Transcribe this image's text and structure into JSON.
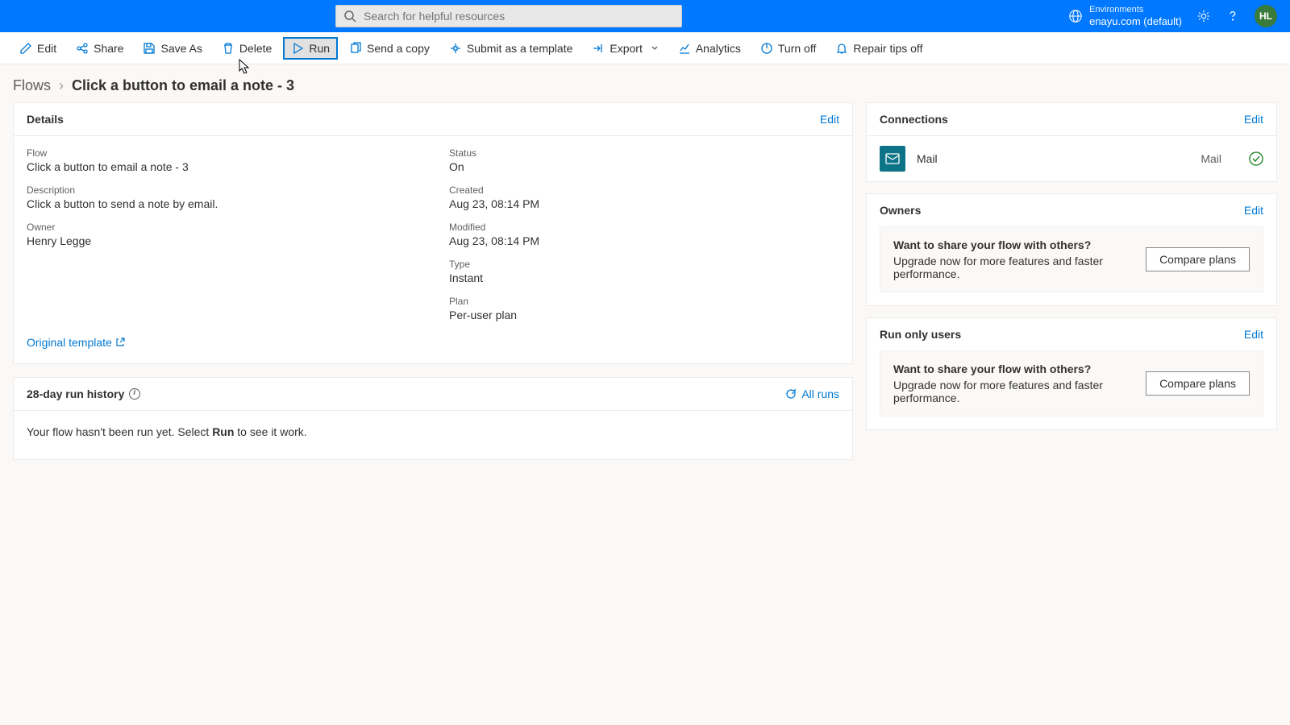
{
  "header": {
    "search_placeholder": "Search for helpful resources",
    "env_label": "Environments",
    "env_name": "enayu.com (default)",
    "avatar_initials": "HL"
  },
  "commands": {
    "edit": "Edit",
    "share": "Share",
    "save_as": "Save As",
    "delete": "Delete",
    "run": "Run",
    "send_copy": "Send a copy",
    "submit_template": "Submit as a template",
    "export": "Export",
    "analytics": "Analytics",
    "turn_off": "Turn off",
    "repair_tips_off": "Repair tips off"
  },
  "breadcrumb": {
    "root": "Flows",
    "current": "Click a button to email a note - 3"
  },
  "details": {
    "title": "Details",
    "edit": "Edit",
    "flow_label": "Flow",
    "flow_value": "Click a button to email a note - 3",
    "desc_label": "Description",
    "desc_value": "Click a button to send a note by email.",
    "owner_label": "Owner",
    "owner_value": "Henry Legge",
    "status_label": "Status",
    "status_value": "On",
    "created_label": "Created",
    "created_value": "Aug 23, 08:14 PM",
    "modified_label": "Modified",
    "modified_value": "Aug 23, 08:14 PM",
    "type_label": "Type",
    "type_value": "Instant",
    "plan_label": "Plan",
    "plan_value": "Per-user plan",
    "original_template": "Original template"
  },
  "history": {
    "title": "28-day run history",
    "all_runs": "All runs",
    "empty_pre": "Your flow hasn't been run yet. Select ",
    "empty_bold": "Run",
    "empty_post": " to see it work."
  },
  "connections": {
    "title": "Connections",
    "edit": "Edit",
    "item_name": "Mail",
    "item_type": "Mail"
  },
  "owners": {
    "title": "Owners",
    "edit": "Edit",
    "upgrade_title": "Want to share your flow with others?",
    "upgrade_desc": "Upgrade now for more features and faster performance.",
    "compare": "Compare plans"
  },
  "run_only": {
    "title": "Run only users",
    "edit": "Edit",
    "upgrade_title": "Want to share your flow with others?",
    "upgrade_desc": "Upgrade now for more features and faster performance.",
    "compare": "Compare plans"
  }
}
